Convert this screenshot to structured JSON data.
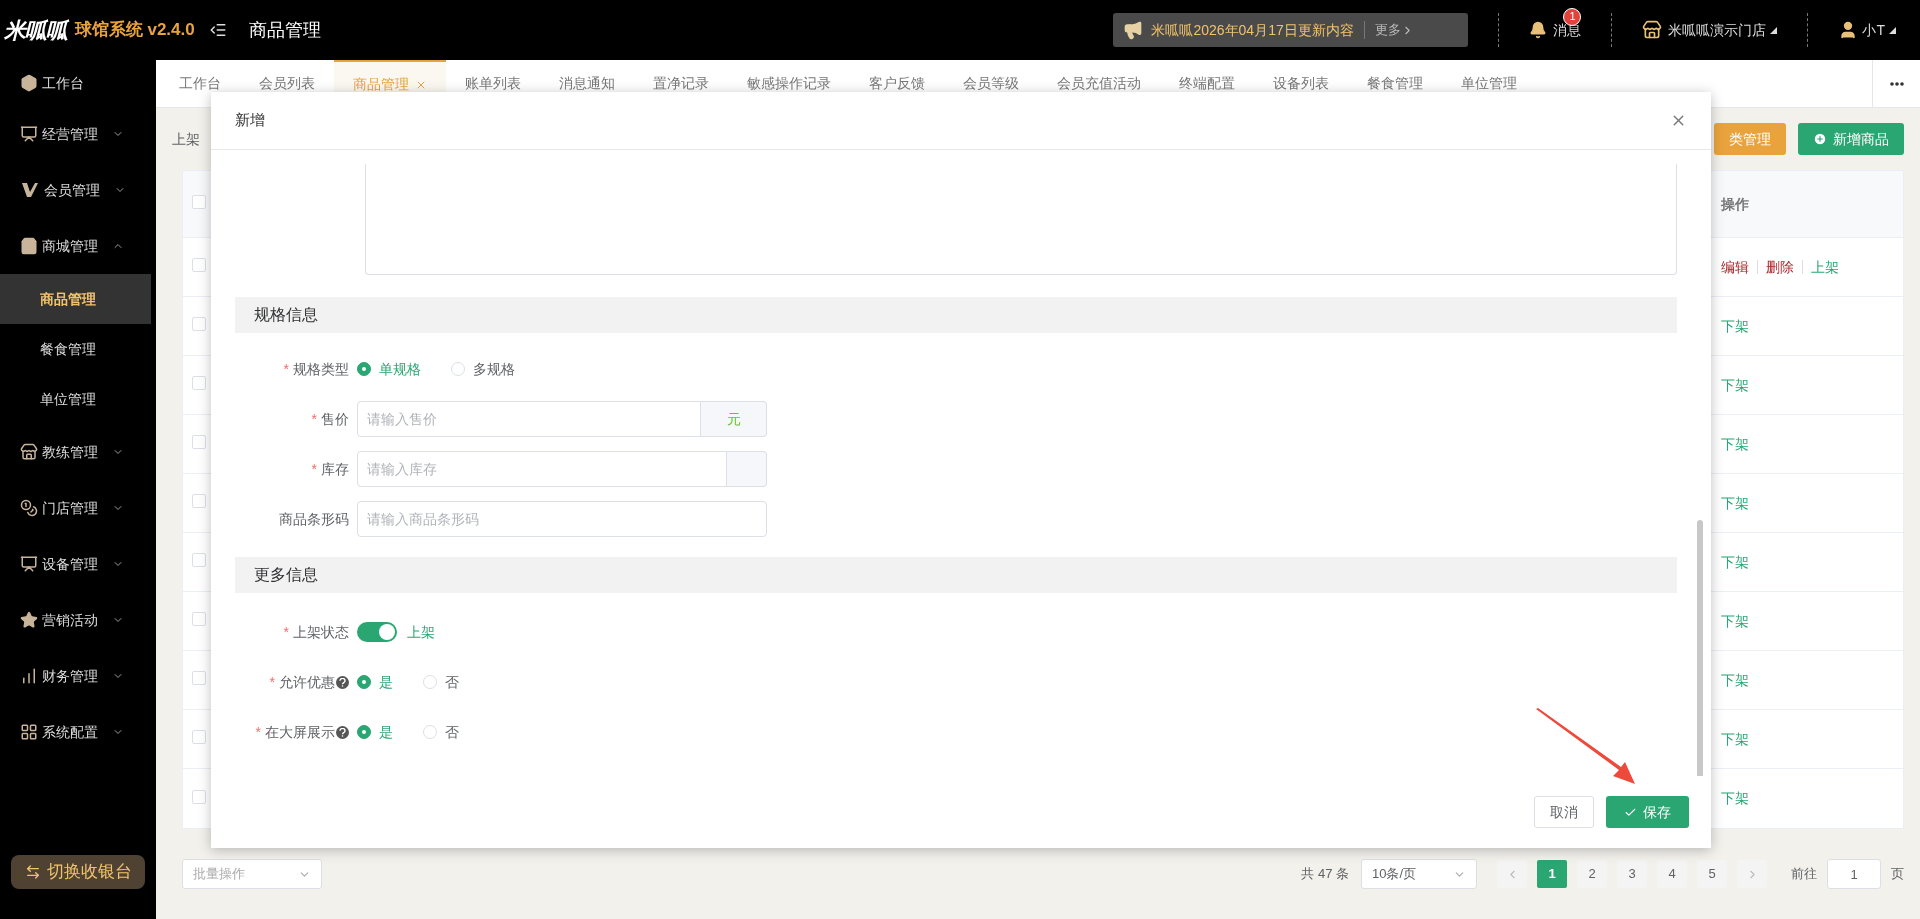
{
  "header": {
    "logo": "米呱呱",
    "app_name": "球馆系统 v2.4.0",
    "page_title": "商品管理",
    "notice": {
      "text": "米呱呱2026年04月17日更新内容",
      "more": "更多"
    },
    "messages": {
      "label": "消息",
      "badge": "1"
    },
    "store": "米呱呱演示门店",
    "user": "小T"
  },
  "sidebar": {
    "items": [
      {
        "label": "工作台",
        "kind": "link"
      },
      {
        "label": "经营管理",
        "kind": "group",
        "expanded": false
      },
      {
        "label": "会员管理",
        "kind": "group",
        "expanded": false
      },
      {
        "label": "商城管理",
        "kind": "group",
        "expanded": true,
        "children": [
          {
            "label": "商品管理",
            "selected": true
          },
          {
            "label": "餐食管理",
            "selected": false
          },
          {
            "label": "单位管理",
            "selected": false
          }
        ]
      },
      {
        "label": "教练管理",
        "kind": "group",
        "expanded": false
      },
      {
        "label": "门店管理",
        "kind": "group",
        "expanded": false
      },
      {
        "label": "设备管理",
        "kind": "group",
        "expanded": false
      },
      {
        "label": "营销活动",
        "kind": "group",
        "expanded": false
      },
      {
        "label": "财务管理",
        "kind": "group",
        "expanded": false
      },
      {
        "label": "系统配置",
        "kind": "group",
        "expanded": false
      }
    ],
    "switch_button": "切换收银台"
  },
  "tabs": [
    {
      "label": "工作台",
      "selected": false
    },
    {
      "label": "会员列表",
      "selected": false
    },
    {
      "label": "商品管理",
      "selected": true
    },
    {
      "label": "账单列表",
      "selected": false
    },
    {
      "label": "消息通知",
      "selected": false
    },
    {
      "label": "置净记录",
      "selected": false
    },
    {
      "label": "敏感操作记录",
      "selected": false
    },
    {
      "label": "客户反馈",
      "selected": false
    },
    {
      "label": "会员等级",
      "selected": false
    },
    {
      "label": "会员充值活动",
      "selected": false
    },
    {
      "label": "终端配置",
      "selected": false
    },
    {
      "label": "设备列表",
      "selected": false
    },
    {
      "label": "餐食管理",
      "selected": false
    },
    {
      "label": "单位管理",
      "selected": false
    }
  ],
  "toolbar": {
    "filter_label": "上架",
    "buttons": [
      {
        "label": "类管理",
        "kind": "warning"
      },
      {
        "label": "新增商品",
        "kind": "primary"
      }
    ]
  },
  "table": {
    "header_checked": false,
    "columns": [
      "操作"
    ],
    "rows": [
      {
        "checked": false,
        "actions": [
          {
            "label": "编辑",
            "kind": "edit"
          },
          {
            "label": "删除",
            "kind": "delete"
          },
          {
            "label": "上架",
            "kind": "toggle"
          }
        ]
      },
      {
        "checked": false,
        "actions": [
          {
            "label": "下架",
            "kind": "toggle"
          }
        ]
      },
      {
        "checked": false,
        "actions": [
          {
            "label": "下架",
            "kind": "toggle"
          }
        ]
      },
      {
        "checked": false,
        "actions": [
          {
            "label": "下架",
            "kind": "toggle"
          }
        ]
      },
      {
        "checked": false,
        "actions": [
          {
            "label": "下架",
            "kind": "toggle"
          }
        ]
      },
      {
        "checked": false,
        "actions": [
          {
            "label": "下架",
            "kind": "toggle"
          }
        ]
      },
      {
        "checked": false,
        "actions": [
          {
            "label": "下架",
            "kind": "toggle"
          }
        ]
      },
      {
        "checked": false,
        "actions": [
          {
            "label": "下架",
            "kind": "toggle"
          }
        ]
      },
      {
        "checked": false,
        "actions": [
          {
            "label": "下架",
            "kind": "toggle"
          }
        ]
      },
      {
        "checked": false,
        "actions": [
          {
            "label": "下架",
            "kind": "toggle"
          }
        ]
      }
    ]
  },
  "pagination": {
    "batch_placeholder": "批量操作",
    "total": "共 47 条",
    "page_size": "10条/页",
    "pages": [
      {
        "label": "1",
        "selected": true
      },
      {
        "label": "2",
        "selected": false
      },
      {
        "label": "3",
        "selected": false
      },
      {
        "label": "4",
        "selected": false
      },
      {
        "label": "5",
        "selected": false
      }
    ],
    "goto_label": "前往",
    "goto_value": "1",
    "page_suffix": "页"
  },
  "modal": {
    "title": "新增",
    "sections": [
      {
        "title": "规格信息",
        "fields": [
          {
            "kind": "radio",
            "label": "规格类型",
            "required_mark": "*",
            "options": [
              {
                "label": "单规格",
                "selected": true
              },
              {
                "label": "多规格",
                "selected": false
              }
            ]
          },
          {
            "kind": "input",
            "label": "售价",
            "required_mark": "*",
            "placeholder": "请输入售价",
            "append": true,
            "suffix": "元"
          },
          {
            "kind": "input",
            "label": "库存",
            "required_mark": "*",
            "placeholder": "请输入库存",
            "append": true
          },
          {
            "kind": "input",
            "label": "商品条形码",
            "placeholder": "请输入商品条形码"
          }
        ]
      },
      {
        "title": "更多信息",
        "fields": [
          {
            "kind": "switch",
            "label": "上架状态",
            "required_mark": "*",
            "on": true,
            "text": "上架"
          },
          {
            "kind": "radio",
            "label": "允许优惠",
            "required_mark": "*",
            "help": true,
            "options": [
              {
                "label": "是",
                "selected": true
              },
              {
                "label": "否",
                "selected": false
              }
            ]
          },
          {
            "kind": "radio",
            "label": "在大屏展示",
            "required_mark": "*",
            "help": true,
            "options": [
              {
                "label": "是",
                "selected": true
              },
              {
                "label": "否",
                "selected": false
              }
            ]
          }
        ]
      }
    ],
    "buttons": [
      {
        "label": "取消",
        "kind": "default"
      },
      {
        "label": "保存",
        "kind": "primary"
      }
    ]
  }
}
